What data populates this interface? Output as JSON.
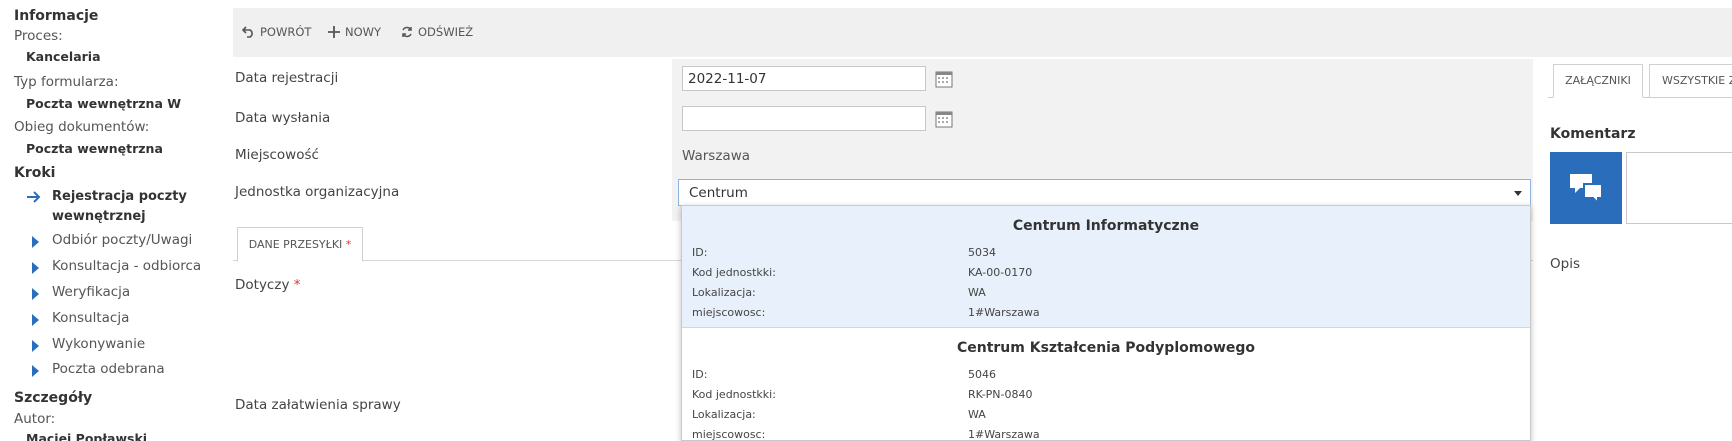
{
  "sidebar": {
    "info_heading": "Informacje",
    "process_label": "Proces:",
    "process_value": "Kancelaria",
    "form_type_label": "Typ formularza:",
    "form_type_value": "Poczta wewnętrzna W",
    "doc_flow_label": "Obieg dokumentów:",
    "doc_flow_value": "Poczta wewnętrzna",
    "steps_heading": "Kroki",
    "steps": [
      {
        "label": "Rejestracja poczty wewnętrznej",
        "active": true
      },
      {
        "label": "Odbiór poczty/Uwagi"
      },
      {
        "label": "Konsultacja - odbiorca"
      },
      {
        "label": "Weryfikacja"
      },
      {
        "label": "Konsultacja"
      },
      {
        "label": "Wykonywanie"
      },
      {
        "label": "Poczta odebrana"
      }
    ],
    "details_heading": "Szczegóły",
    "author_label": "Autor:",
    "author_value": "Maciej Popławski"
  },
  "toolbar": {
    "back_label": "POWRÓT",
    "new_label": "NOWY",
    "refresh_label": "ODŚWIEŻ"
  },
  "form": {
    "registration_date_label": "Data rejestracji",
    "registration_date_value": "2022-11-07",
    "send_date_label": "Data wysłania",
    "send_date_value": "",
    "city_label": "Miejscowość",
    "city_value": "Warszawa",
    "org_unit_label": "Jednostka organizacyjna",
    "org_unit_value": "Centrum",
    "tab_label": "DANE PRZESYŁKI",
    "required_mark": "*",
    "concerns_label": "Dotyczy",
    "resolution_date_label": "Data załatwienia sprawy"
  },
  "dropdown": {
    "keys": {
      "id": "ID:",
      "code": "Kod jednostkki:",
      "location": "Lokalizacja:",
      "city": "miejscowosc:"
    },
    "items": [
      {
        "title": "Centrum Informatyczne",
        "id": "5034",
        "code": "KA-00-0170",
        "location": "WA",
        "city": "1#Warszawa",
        "selected": true
      },
      {
        "title": "Centrum Kształcenia Podyplomowego",
        "id": "5046",
        "code": "RK-PN-0840",
        "location": "WA",
        "city": "1#Warszawa"
      }
    ]
  },
  "right_panel": {
    "tab_attachments": "ZAŁĄCZNIKI",
    "tab_all": "WSZYSTKIE ZAŁĄCZNIKI",
    "comment_heading": "Komentarz",
    "description_label": "Opis"
  },
  "colors": {
    "accent": "#2a6ebb",
    "toolbar_bg": "#f0f0f0",
    "selected_bg": "#e8f1fb"
  }
}
